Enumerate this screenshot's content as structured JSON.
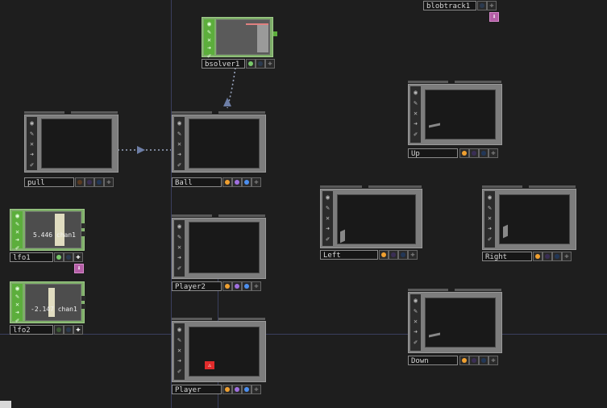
{
  "nodes": {
    "bsolver1": {
      "label": "bsolver1"
    },
    "blobtrack1": {
      "label": "blobtrack1"
    },
    "pull": {
      "label": "pull"
    },
    "ball": {
      "label": "Ball"
    },
    "up": {
      "label": "Up"
    },
    "lfo1": {
      "label": "lfo1",
      "value": "5.446 chan1"
    },
    "lfo2": {
      "label": "lfo2",
      "value": "-2.147 chan1"
    },
    "player2": {
      "label": "Player2"
    },
    "left": {
      "label": "Left"
    },
    "right": {
      "label": "Right"
    },
    "down": {
      "label": "Down"
    },
    "player": {
      "label": "Player"
    }
  },
  "icons": {
    "side": [
      "target-icon",
      "pencil-icon",
      "x-icon",
      "arrow-icon",
      "brush-icon"
    ],
    "flag": "plus-icon",
    "pink_badge": "download-icon",
    "red_badge": "warning-icon"
  },
  "colors": {
    "background": "#1e1e1e",
    "grid_line": "#3a3f5e",
    "chop_green": "#5cae3c",
    "flag_orange": "#f0a030",
    "flag_purple": "#a070e0",
    "flag_blue": "#4c8ff0",
    "flag_green": "#78c86a",
    "pink_badge": "#b45ea6",
    "red_badge": "#e12b2b"
  }
}
